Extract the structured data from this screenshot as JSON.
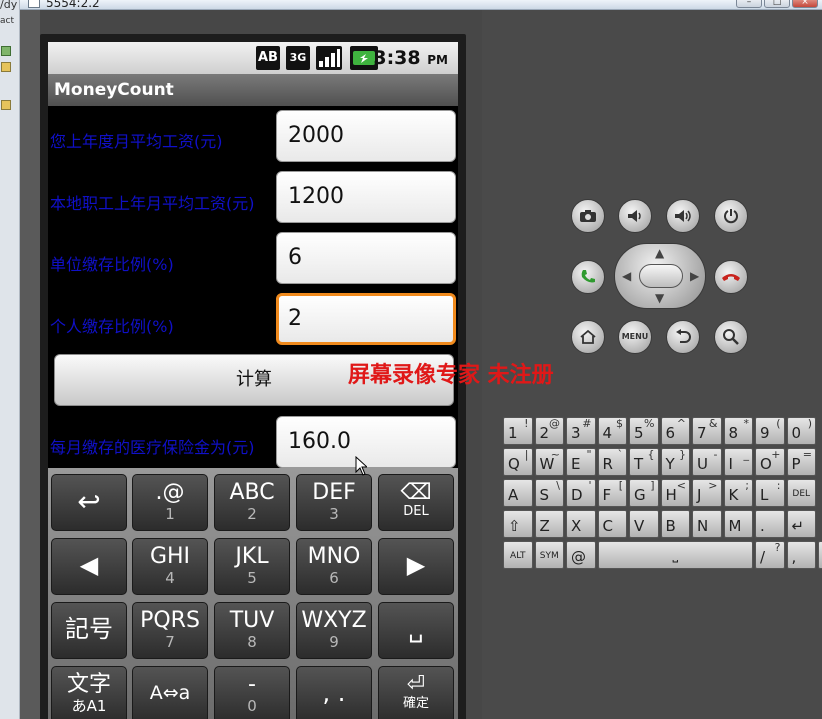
{
  "host_window": {
    "title": "5554:2.2",
    "sidebar_fragments": [
      "/dy",
      "act"
    ]
  },
  "status_bar": {
    "icons": [
      "AB",
      "3G",
      "signal",
      "battery"
    ],
    "time": "3:38",
    "ampm": "PM"
  },
  "app": {
    "title": "MoneyCount"
  },
  "form": {
    "fields": [
      {
        "label": "您上年度月平均工资(元)",
        "value": "2000"
      },
      {
        "label": "本地职工上年月平均工资(元)",
        "value": "1200"
      },
      {
        "label": "单位缴存比例(%)",
        "value": "6"
      },
      {
        "label": "个人缴存比例(%)",
        "value": "2"
      }
    ],
    "calc_button": "计算",
    "result_label": "每月缴存的医疗保险金为(元)",
    "result_value": "160.0"
  },
  "soft_keyboard": {
    "keys": [
      {
        "main": "↩",
        "sub": ""
      },
      {
        "main": ".@",
        "sub": "1"
      },
      {
        "main": "ABC",
        "sub": "2"
      },
      {
        "main": "DEF",
        "sub": "3"
      },
      {
        "main": "⌫",
        "sub": "DEL"
      },
      {
        "main": "◀",
        "sub": ""
      },
      {
        "main": "GHI",
        "sub": "4"
      },
      {
        "main": "JKL",
        "sub": "5"
      },
      {
        "main": "MNO",
        "sub": "6"
      },
      {
        "main": "▶",
        "sub": ""
      },
      {
        "main": "記号",
        "sub": ""
      },
      {
        "main": "PQRS",
        "sub": "7"
      },
      {
        "main": "TUV",
        "sub": "8"
      },
      {
        "main": "WXYZ",
        "sub": "9"
      },
      {
        "main": "␣",
        "sub": ""
      },
      {
        "main": "文字",
        "sub": "あA1"
      },
      {
        "main": "A⇔a",
        "sub": ""
      },
      {
        "main": "-",
        "sub": "0"
      },
      {
        "main": ",  .",
        "sub": ""
      },
      {
        "main": "⏎",
        "sub": "確定"
      }
    ]
  },
  "emulator_controls": {
    "top_row": [
      "camera-icon",
      "volume-down-icon",
      "volume-up-icon",
      "power-icon"
    ],
    "call_icon": "call-icon",
    "end_call_icon": "end-call-icon",
    "bottom_row": [
      "home-icon",
      "MENU",
      "back-icon",
      "search-icon"
    ]
  },
  "hardware_keyboard": {
    "rows": [
      [
        [
          "1",
          "!"
        ],
        [
          "2",
          "@"
        ],
        [
          "3",
          "#"
        ],
        [
          "4",
          "$"
        ],
        [
          "5",
          "%"
        ],
        [
          "6",
          "^"
        ],
        [
          "7",
          "&"
        ],
        [
          "8",
          "*"
        ],
        [
          "9",
          "("
        ],
        [
          "0",
          ")"
        ]
      ],
      [
        [
          "Q",
          "|"
        ],
        [
          "W",
          "~"
        ],
        [
          "E",
          "\""
        ],
        [
          "R",
          "`"
        ],
        [
          "T",
          "{"
        ],
        [
          "Y",
          "}"
        ],
        [
          "U",
          "-"
        ],
        [
          "I",
          "_"
        ],
        [
          "O",
          "+"
        ],
        [
          "P",
          "="
        ]
      ],
      [
        [
          "A",
          ""
        ],
        [
          "S",
          "\\"
        ],
        [
          "D",
          "'"
        ],
        [
          "F",
          "["
        ],
        [
          "G",
          "]"
        ],
        [
          "H",
          "<"
        ],
        [
          "J",
          ">"
        ],
        [
          "K",
          ";"
        ],
        [
          "L",
          ":"
        ],
        [
          "DEL",
          ""
        ]
      ],
      [
        [
          "⇧",
          ""
        ],
        [
          "Z",
          ""
        ],
        [
          "X",
          ""
        ],
        [
          "C",
          ""
        ],
        [
          "V",
          ""
        ],
        [
          "B",
          ""
        ],
        [
          "N",
          ""
        ],
        [
          "M",
          ""
        ],
        [
          ".",
          ""
        ],
        [
          "↵",
          ""
        ]
      ],
      [
        [
          "ALT",
          ""
        ],
        [
          "SYM",
          ""
        ],
        [
          "@",
          ""
        ],
        [
          "space",
          ""
        ],
        [
          "/",
          "?"
        ],
        [
          ",",
          ""
        ],
        [
          "ALT",
          ""
        ]
      ]
    ]
  },
  "watermark": "屏幕录像专家  未注册",
  "colors": {
    "label": "#1010c8",
    "focus": "#f08a1d",
    "watermark": "#e01818"
  }
}
